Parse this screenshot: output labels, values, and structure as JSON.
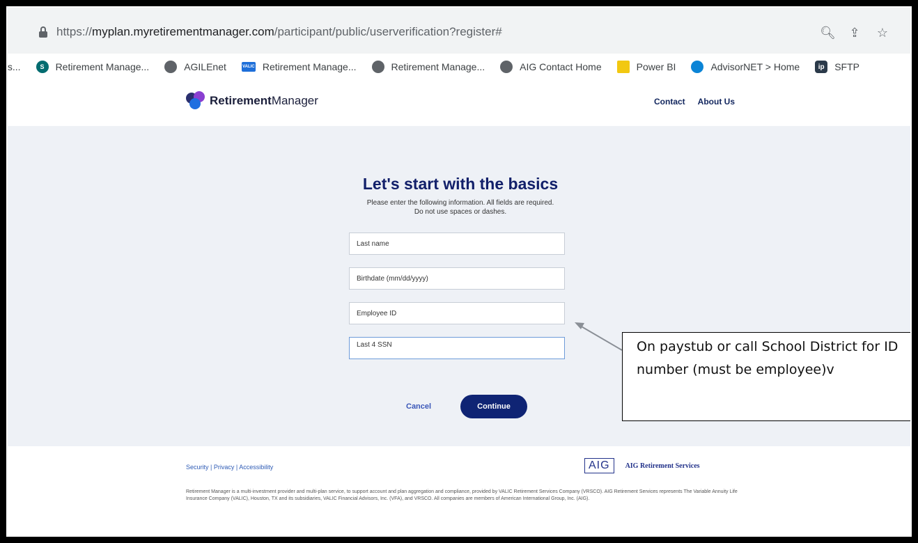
{
  "browser": {
    "url_prefix": "https://",
    "url_host": "myplan.myretirementmanager.com",
    "url_path": "/participant/public/userverification?register#",
    "bookmarks": [
      {
        "label": "ts...",
        "icon": "none"
      },
      {
        "label": "Retirement Manage...",
        "icon": "sharepoint-icon"
      },
      {
        "label": "AGILEnet",
        "icon": "globe-icon"
      },
      {
        "label": "Retirement Manage...",
        "icon": "valic-icon"
      },
      {
        "label": "Retirement Manage...",
        "icon": "globe-icon"
      },
      {
        "label": "AIG Contact Home",
        "icon": "globe-icon"
      },
      {
        "label": "Power BI",
        "icon": "powerbi-icon"
      },
      {
        "label": "AdvisorNET > Home",
        "icon": "advisornet-icon"
      },
      {
        "label": "SFTP",
        "icon": "ip-icon"
      }
    ],
    "valic_icon_text": "VALIC",
    "ip_icon_text": "ip",
    "sharepoint_icon_text": "S"
  },
  "header": {
    "logo_bold": "Retirement",
    "logo_light": "Manager",
    "nav": [
      "Contact",
      "About Us"
    ]
  },
  "form": {
    "title": "Let's start with the basics",
    "subtitle_line1": "Please enter the following information. All fields are required.",
    "subtitle_line2": "Do not use spaces or dashes.",
    "fields": {
      "last_name": "Last name",
      "birthdate": "Birthdate (mm/dd/yyyy)",
      "employee_id": "Employee ID",
      "last4_ssn": "Last 4 SSN"
    },
    "cancel_label": "Cancel",
    "continue_label": "Continue"
  },
  "callout": {
    "text": "On paystub or call School District for ID number (must be employee)v"
  },
  "footer": {
    "links": [
      "Security",
      "Privacy",
      "Accessibility"
    ],
    "link_separator": "|",
    "aig_logo": "AIG",
    "aig_name": "AIG Retirement Services",
    "disclaimer": "Retirement Manager is a multi-investment provider and multi-plan service, to support account and plan aggregation and compliance, provided by VALIC Retirement Services Company (VRSCO). AIG Retirement Services represents The Variable Annuity Life Insurance Company (VALIC), Houston, TX and its subsidiaries, VALIC Financial Advisors, Inc. (VFA), and VRSCO. All companies are members of American International Group, Inc. (AIG)."
  },
  "colors": {
    "brand_navy": "#12206a",
    "button_navy": "#0f2474",
    "link_blue": "#2e5bb5"
  }
}
